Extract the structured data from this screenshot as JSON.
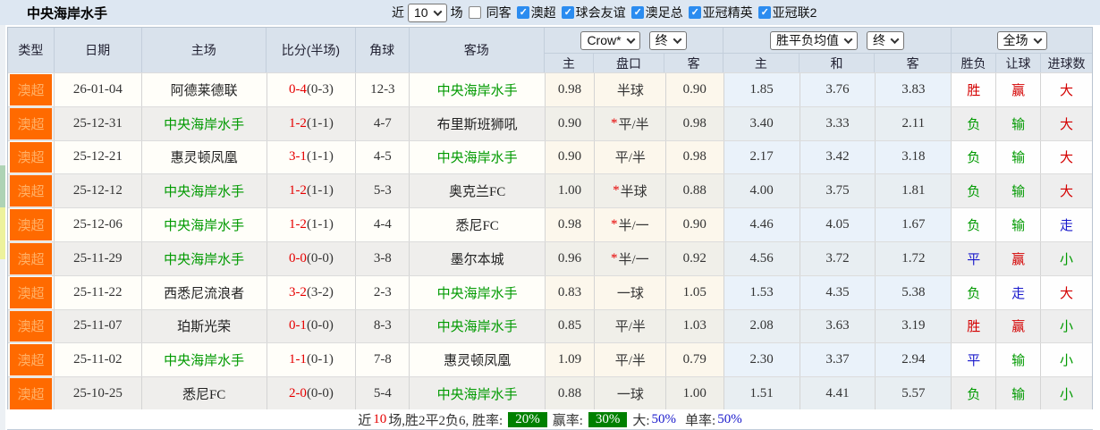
{
  "topbar": {
    "title": "中央海岸水手",
    "near_label": "近",
    "games_count": "10",
    "games_label": "场",
    "same_opponent_label": "同客",
    "leagues": [
      {
        "label": "澳超"
      },
      {
        "label": "球会友谊"
      },
      {
        "label": "澳足总"
      },
      {
        "label": "亚冠精英"
      },
      {
        "label": "亚冠联2"
      }
    ]
  },
  "header": {
    "type": "类型",
    "date": "日期",
    "home": "主场",
    "score": "比分(半场)",
    "corner": "角球",
    "away": "客场",
    "odds_select": "Crow*",
    "odds_final_select": "终",
    "odds_home": "主",
    "odds_handicap": "盘口",
    "odds_away": "客",
    "mean_select": "胜平负均值",
    "mean_final_select": "终",
    "mean_home": "主",
    "mean_draw": "和",
    "mean_away": "客",
    "scope_select": "全场",
    "result": "胜负",
    "handicap_result": "让球",
    "goals": "进球数"
  },
  "rows": [
    {
      "league": "澳超",
      "date": "26-01-04",
      "home": "阿德莱德联",
      "home_color": "black",
      "score_ft": "0-4",
      "score_ht": "(0-3)",
      "corner": "12-3",
      "away": "中央海岸水手",
      "away_color": "green",
      "odds_home": "0.98",
      "star": "",
      "handicap": "半球",
      "odds_away": "0.90",
      "mean_home": "1.85",
      "mean_draw": "3.76",
      "mean_away": "3.83",
      "result": "胜",
      "result_color": "red",
      "let_result": "赢",
      "let_color": "red",
      "goal_result": "大",
      "goal_color": "red"
    },
    {
      "league": "澳超",
      "date": "25-12-31",
      "home": "中央海岸水手",
      "home_color": "green",
      "score_ft": "1-2",
      "score_ht": "(1-1)",
      "corner": "4-7",
      "away": "布里斯班狮吼",
      "away_color": "black",
      "odds_home": "0.90",
      "star": "*",
      "handicap": "平/半",
      "odds_away": "0.98",
      "mean_home": "3.40",
      "mean_draw": "3.33",
      "mean_away": "2.11",
      "result": "负",
      "result_color": "green",
      "let_result": "输",
      "let_color": "green",
      "goal_result": "大",
      "goal_color": "red"
    },
    {
      "league": "澳超",
      "date": "25-12-21",
      "home": "惠灵顿凤凰",
      "home_color": "black",
      "score_ft": "3-1",
      "score_ht": "(1-1)",
      "corner": "4-5",
      "away": "中央海岸水手",
      "away_color": "green",
      "odds_home": "0.90",
      "star": "",
      "handicap": "平/半",
      "odds_away": "0.98",
      "mean_home": "2.17",
      "mean_draw": "3.42",
      "mean_away": "3.18",
      "result": "负",
      "result_color": "green",
      "let_result": "输",
      "let_color": "green",
      "goal_result": "大",
      "goal_color": "red"
    },
    {
      "league": "澳超",
      "date": "25-12-12",
      "home": "中央海岸水手",
      "home_color": "green",
      "score_ft": "1-2",
      "score_ht": "(1-1)",
      "corner": "5-3",
      "away": "奥克兰FC",
      "away_color": "black",
      "odds_home": "1.00",
      "star": "*",
      "handicap": "半球",
      "odds_away": "0.88",
      "mean_home": "4.00",
      "mean_draw": "3.75",
      "mean_away": "1.81",
      "result": "负",
      "result_color": "green",
      "let_result": "输",
      "let_color": "green",
      "goal_result": "大",
      "goal_color": "red"
    },
    {
      "league": "澳超",
      "date": "25-12-06",
      "home": "中央海岸水手",
      "home_color": "green",
      "score_ft": "1-2",
      "score_ht": "(1-1)",
      "corner": "4-4",
      "away": "悉尼FC",
      "away_color": "black",
      "odds_home": "0.98",
      "star": "*",
      "handicap": "半/一",
      "odds_away": "0.90",
      "mean_home": "4.46",
      "mean_draw": "4.05",
      "mean_away": "1.67",
      "result": "负",
      "result_color": "green",
      "let_result": "输",
      "let_color": "green",
      "goal_result": "走",
      "goal_color": "blue"
    },
    {
      "league": "澳超",
      "date": "25-11-29",
      "home": "中央海岸水手",
      "home_color": "green",
      "score_ft": "0-0",
      "score_ht": "(0-0)",
      "corner": "3-8",
      "away": "墨尔本城",
      "away_color": "black",
      "odds_home": "0.96",
      "star": "*",
      "handicap": "半/一",
      "odds_away": "0.92",
      "mean_home": "4.56",
      "mean_draw": "3.72",
      "mean_away": "1.72",
      "result": "平",
      "result_color": "blue",
      "let_result": "赢",
      "let_color": "red",
      "goal_result": "小",
      "goal_color": "green"
    },
    {
      "league": "澳超",
      "date": "25-11-22",
      "home": "西悉尼流浪者",
      "home_color": "black",
      "score_ft": "3-2",
      "score_ht": "(3-2)",
      "corner": "2-3",
      "away": "中央海岸水手",
      "away_color": "green",
      "odds_home": "0.83",
      "star": "",
      "handicap": "一球",
      "odds_away": "1.05",
      "mean_home": "1.53",
      "mean_draw": "4.35",
      "mean_away": "5.38",
      "result": "负",
      "result_color": "green",
      "let_result": "走",
      "let_color": "blue",
      "goal_result": "大",
      "goal_color": "red"
    },
    {
      "league": "澳超",
      "date": "25-11-07",
      "home": "珀斯光荣",
      "home_color": "black",
      "score_ft": "0-1",
      "score_ht": "(0-0)",
      "corner": "8-3",
      "away": "中央海岸水手",
      "away_color": "green",
      "odds_home": "0.85",
      "star": "",
      "handicap": "平/半",
      "odds_away": "1.03",
      "mean_home": "2.08",
      "mean_draw": "3.63",
      "mean_away": "3.19",
      "result": "胜",
      "result_color": "red",
      "let_result": "赢",
      "let_color": "red",
      "goal_result": "小",
      "goal_color": "green"
    },
    {
      "league": "澳超",
      "date": "25-11-02",
      "home": "中央海岸水手",
      "home_color": "green",
      "score_ft": "1-1",
      "score_ht": "(0-1)",
      "corner": "7-8",
      "away": "惠灵顿凤凰",
      "away_color": "black",
      "odds_home": "1.09",
      "star": "",
      "handicap": "平/半",
      "odds_away": "0.79",
      "mean_home": "2.30",
      "mean_draw": "3.37",
      "mean_away": "2.94",
      "result": "平",
      "result_color": "blue",
      "let_result": "输",
      "let_color": "green",
      "goal_result": "小",
      "goal_color": "green"
    },
    {
      "league": "澳超",
      "date": "25-10-25",
      "home": "悉尼FC",
      "home_color": "black",
      "score_ft": "2-0",
      "score_ht": "(0-0)",
      "corner": "5-4",
      "away": "中央海岸水手",
      "away_color": "green",
      "odds_home": "0.88",
      "star": "",
      "handicap": "一球",
      "odds_away": "1.00",
      "mean_home": "1.51",
      "mean_draw": "4.41",
      "mean_away": "5.57",
      "result": "负",
      "result_color": "green",
      "let_result": "输",
      "let_color": "green",
      "goal_result": "小",
      "goal_color": "green"
    }
  ],
  "footer": {
    "near_label": "近",
    "count": "10",
    "summary": "场,胜2平2负6, 胜率:",
    "win_rate": "20%",
    "let_label": "赢率:",
    "let_rate": "30%",
    "big_label": "大:",
    "big_rate": "50%",
    "single_label": "单率:",
    "single_rate": "50%"
  },
  "colors": {
    "accent_orange": "#ff6a00",
    "win_red": "#d40000",
    "lose_green": "#009a00",
    "draw_blue": "#1a1acc",
    "rate_badge_green": "#008000"
  }
}
